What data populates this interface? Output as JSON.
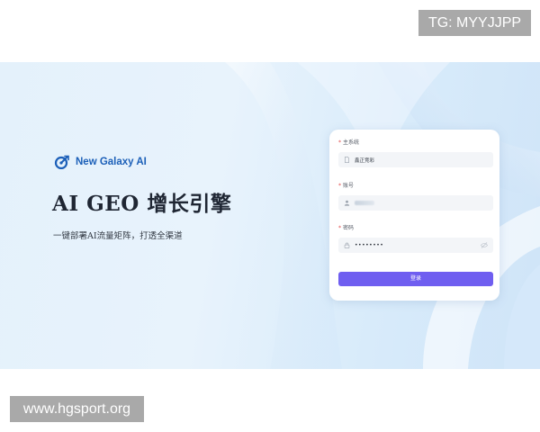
{
  "watermarks": {
    "tg": "TG: MYYJJPP",
    "site": "www.hgsport.org"
  },
  "brand": {
    "name": "New Galaxy AI",
    "icon": "galaxy-logo-icon",
    "color": "#1b5fb8"
  },
  "hero": {
    "headline": "AI GEO 增长引擎",
    "subline": "一键部署AI流量矩阵，打透全渠道"
  },
  "login": {
    "system_label": "主系统",
    "system_value": "鑫正竞彩",
    "account_label": "账号",
    "password_label": "密码",
    "password_value": "••••••••",
    "submit_label": "登录",
    "accent_color": "#6f5ef0"
  }
}
